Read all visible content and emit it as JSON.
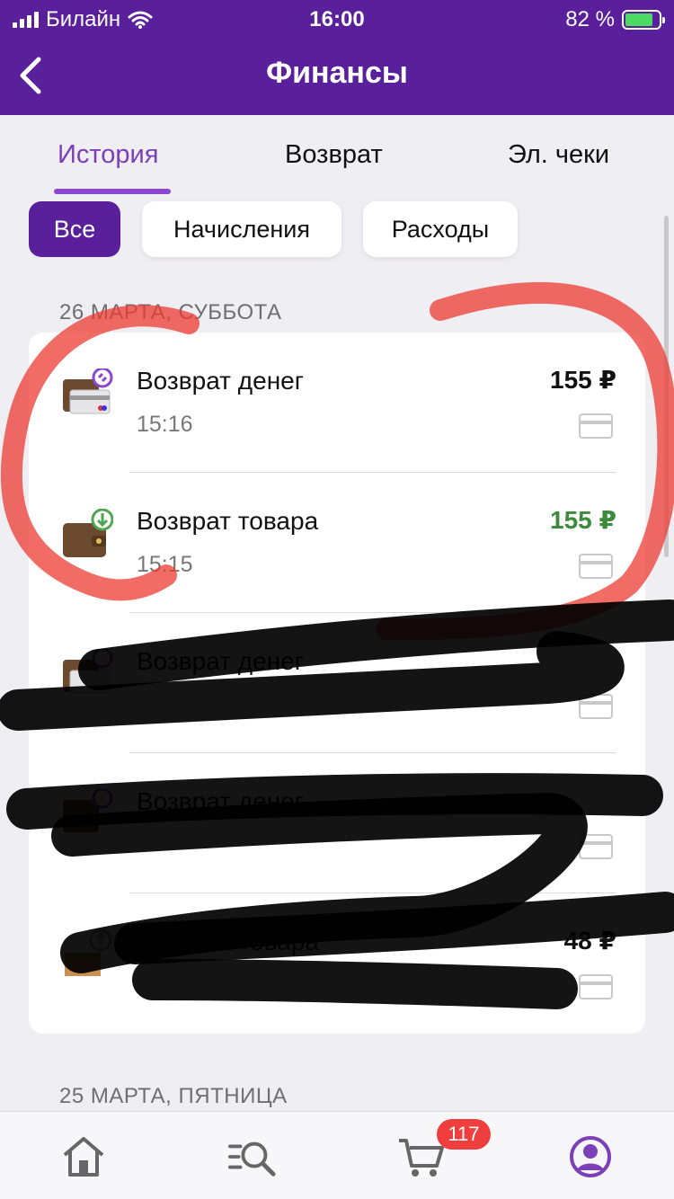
{
  "status_bar": {
    "carrier": "Билайн",
    "time": "16:00",
    "battery": "82 %"
  },
  "header": {
    "title": "Финансы"
  },
  "tabs": [
    {
      "label": "История",
      "active": true
    },
    {
      "label": "Возврат",
      "active": false
    },
    {
      "label": "Эл. чеки",
      "active": false
    }
  ],
  "filters": [
    {
      "label": "Все",
      "active": true
    },
    {
      "label": "Начисления",
      "active": false
    },
    {
      "label": "Расходы",
      "active": false
    }
  ],
  "sections": [
    {
      "date": "26 МАРТА, СУББОТА",
      "items": [
        {
          "name": "Возврат денег",
          "time": "15:16",
          "amount": "155 ₽",
          "amount_color": "#111111",
          "icon": "wallet-card-refund-icon"
        },
        {
          "name": "Возврат товара",
          "time": "15:15",
          "amount": "155 ₽",
          "amount_color": "#3c8a3c",
          "icon": "wallet-download-icon"
        },
        {
          "name": "Возврат денег",
          "time": "",
          "amount": "",
          "amount_color": "#111111",
          "icon": "wallet-card-refund-icon"
        },
        {
          "name": "Возврат денег",
          "time": "",
          "amount": "",
          "amount_color": "#111111",
          "icon": "wallet-card-refund-icon"
        },
        {
          "name": "Покупка товара",
          "time": "",
          "amount": "48 ₽",
          "amount_color": "#111111",
          "icon": "package-upload-icon"
        }
      ]
    },
    {
      "date": "25 МАРТА, ПЯТНИЦА",
      "items": []
    }
  ],
  "bottom_nav": {
    "cart_badge": "117"
  },
  "colors": {
    "brand": "#5a1f9a",
    "accent": "#8b45cf",
    "positive": "#3c8a3c",
    "badge": "#ef3e3e"
  }
}
